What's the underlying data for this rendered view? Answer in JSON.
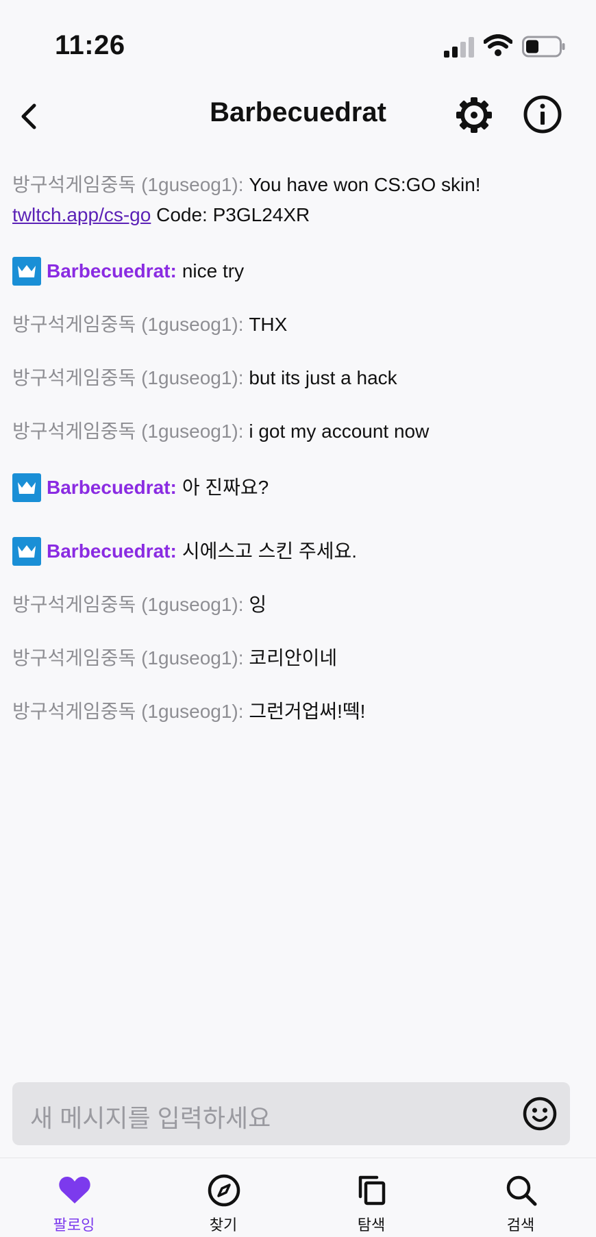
{
  "status": {
    "time": "11:26"
  },
  "header": {
    "title": "Barbecuedrat"
  },
  "messages": [
    {
      "user": "방구석게임중독 (1guseog1):",
      "text_before": " You have won CS:GO skin!",
      "link": "twltch.app/cs-go",
      "text_after": " Code: P3GL24XR"
    },
    {
      "user": "Barbecuedrat:",
      "text": " nice try"
    },
    {
      "user": "방구석게임중독 (1guseog1):",
      "text": " THX"
    },
    {
      "user": "방구석게임중독 (1guseog1):",
      "text": " but its just a hack"
    },
    {
      "user": "방구석게임중독 (1guseog1):",
      "text": " i got my account now"
    },
    {
      "user": "Barbecuedrat:",
      "text": " 아 진짜요?"
    },
    {
      "user": "Barbecuedrat:",
      "text": " 시에스고 스킨 주세요."
    },
    {
      "user": "방구석게임중독 (1guseog1):",
      "text": " 잉"
    },
    {
      "user": "방구석게임중독 (1guseog1):",
      "text": " 코리안이네"
    },
    {
      "user": "방구석게임중독 (1guseog1):",
      "text": " 그런거업써!떽!"
    }
  ],
  "input": {
    "placeholder": "새 메시지를 입력하세요"
  },
  "tabs": [
    {
      "label": "팔로잉"
    },
    {
      "label": "찾기"
    },
    {
      "label": "탐색"
    },
    {
      "label": "검색"
    }
  ],
  "colors": {
    "accent": "#8a2be2",
    "badge": "#1a8fd6",
    "link": "#5b21b6"
  },
  "icons": [
    "back-icon",
    "settings-gear-icon",
    "info-icon",
    "crown-badge-icon",
    "emoji-icon",
    "heart-icon",
    "compass-icon",
    "copy-icon",
    "search-icon"
  ]
}
